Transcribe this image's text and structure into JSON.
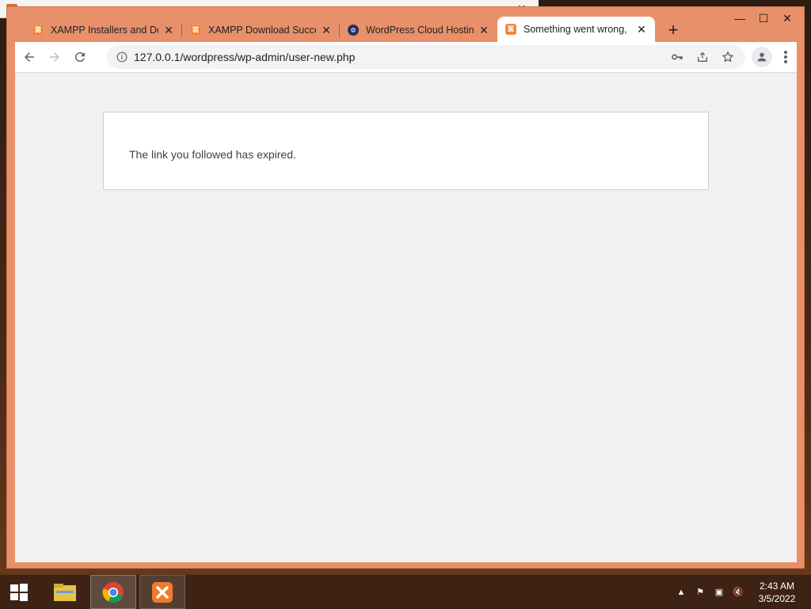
{
  "tabs": [
    {
      "title": "XAMPP Installers and Do",
      "icon": "xampp-icon"
    },
    {
      "title": "XAMPP Download Succe",
      "icon": "xampp-icon"
    },
    {
      "title": "WordPress Cloud Hostin",
      "icon": "wordpress-cloud-icon"
    },
    {
      "title": "Something went wrong,",
      "icon": "xampp-icon",
      "active": true
    }
  ],
  "address_bar": {
    "url": "127.0.0.1/wordpress/wp-admin/user-new.php"
  },
  "page": {
    "message": "The link you followed has expired."
  },
  "taskbar": {
    "time": "2:43 AM",
    "date": "3/5/2022"
  },
  "colors": {
    "window_frame": "#e8906a",
    "page_bg": "#f1f1f1",
    "taskbar": "#3c2214"
  }
}
